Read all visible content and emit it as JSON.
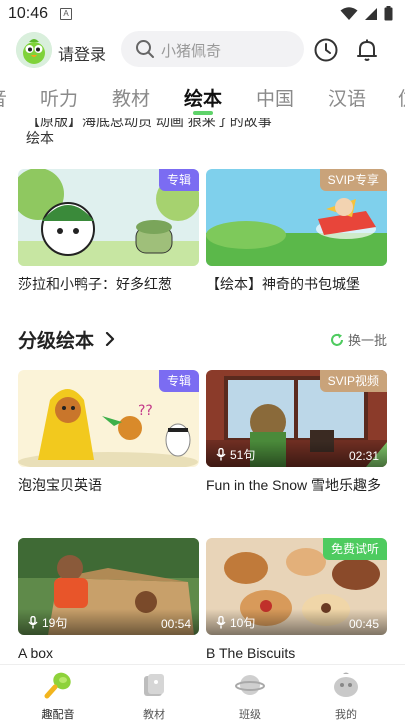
{
  "status_bar": {
    "time": "10:46",
    "sim_label": "A"
  },
  "header": {
    "login_text": "请登录",
    "search_placeholder": "小猪佩奇"
  },
  "tabs": [
    {
      "label": "音"
    },
    {
      "label": "听力"
    },
    {
      "label": "教材"
    },
    {
      "label": "绘本",
      "active": true
    },
    {
      "label": "中国"
    },
    {
      "label": "汉语"
    },
    {
      "label": "仿"
    }
  ],
  "partial_item": {
    "line1": "【原版】海底总动员 动画 狼来了的故事",
    "line2": "绘本"
  },
  "row1": [
    {
      "title": "莎拉和小鸭子：好多红葱",
      "badge": "专辑"
    },
    {
      "title": "【绘本】神奇的书包城堡",
      "badge": "SVIP专享"
    }
  ],
  "section": {
    "title": "分级绘本",
    "refresh_label": "换一批"
  },
  "row2": [
    {
      "title": "泡泡宝贝英语",
      "badge": "专辑"
    },
    {
      "title": "Fun in the Snow 雪地乐趣多",
      "badge": "SVIP视频",
      "count": "51句",
      "duration": "02:31"
    }
  ],
  "row3": [
    {
      "title": "A box",
      "count": "19句",
      "duration": "00:54"
    },
    {
      "title": "B The Biscuits",
      "badge": "免费试听",
      "count": "10句",
      "duration": "00:45"
    }
  ],
  "bottom_nav": [
    {
      "label": "趣配音",
      "active": true
    },
    {
      "label": "教材"
    },
    {
      "label": "班级"
    },
    {
      "label": "我的"
    }
  ],
  "colors": {
    "accent": "#5fd36a",
    "badge_purple": "#7b6cf2",
    "badge_gold": "#c9a37a",
    "badge_green": "#4ecb5f"
  }
}
